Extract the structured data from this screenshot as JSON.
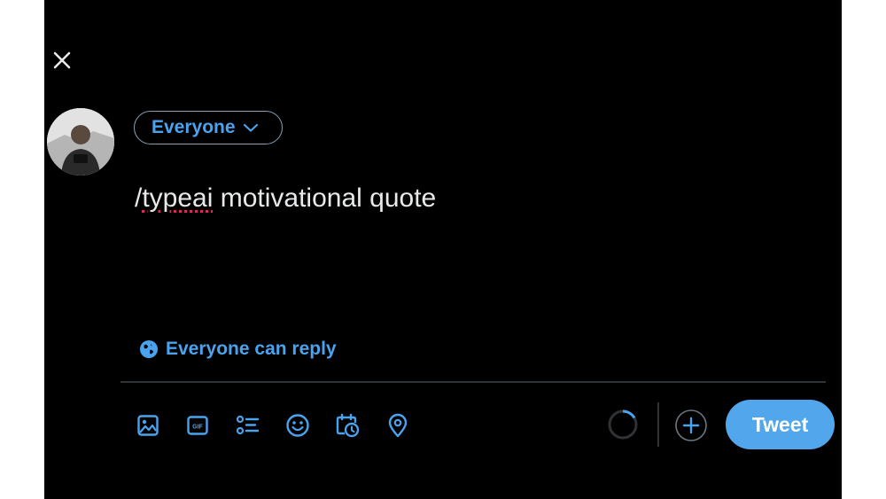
{
  "header": {
    "close_icon": "close-icon"
  },
  "user": {
    "avatar_icon": "avatar-photo"
  },
  "audience": {
    "label": "Everyone",
    "icon": "chevron-down-icon"
  },
  "composer": {
    "text_prefix": "/",
    "text_misspelled": "typeai",
    "text_rest": " motivational quote"
  },
  "reply_setting": {
    "label": "Everyone can reply",
    "icon": "globe-icon"
  },
  "toolbar": {
    "icons": [
      "image-icon",
      "gif-icon",
      "poll-icon",
      "emoji-icon",
      "schedule-icon",
      "location-icon"
    ],
    "add_icon": "plus-circle-icon"
  },
  "actions": {
    "tweet_label": "Tweet"
  },
  "colors": {
    "accent": "#4aa3ee",
    "button_bg": "#52a7ec",
    "background": "#000000",
    "text": "#e7e9ea",
    "divider": "#2f3336"
  }
}
